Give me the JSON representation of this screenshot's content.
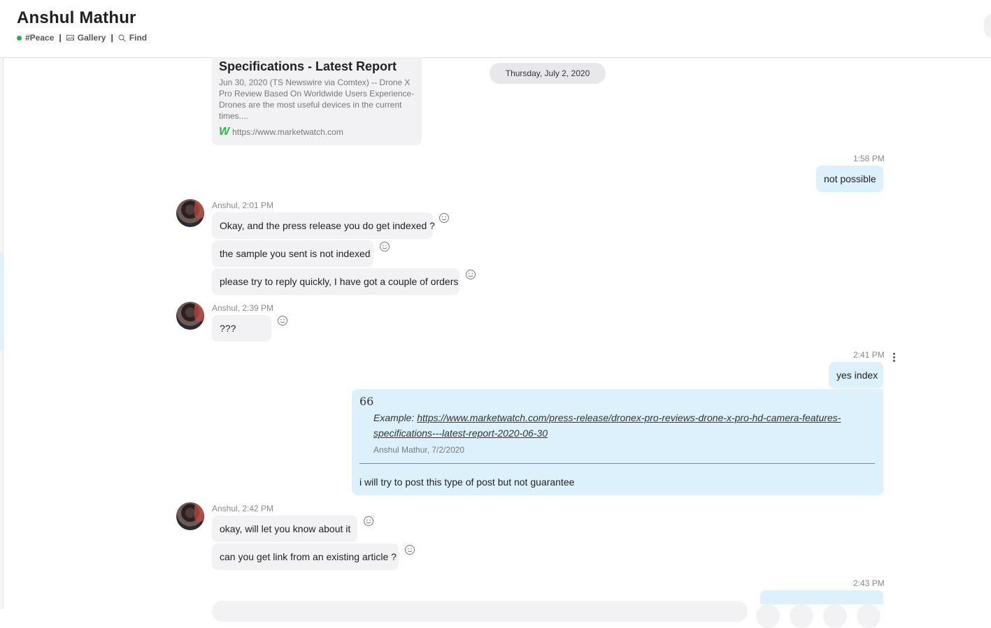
{
  "header": {
    "title": "Anshul Mathur",
    "mood": "#Peace",
    "gallery": "Gallery",
    "find": "Find"
  },
  "link_card": {
    "title": "Specifications - Latest Report",
    "desc": "Jun 30, 2020 (TS Newswire via Comtex) -- Drone X Pro Review Based On Worldwide Users Experience- Drones are the most useful devices in the current times....",
    "url": "https://www.marketwatch.com"
  },
  "date_divider": "Thursday, July 2, 2020",
  "messages": {
    "m1_time": "1:58 PM",
    "m1_text": "not possible",
    "g1_sender": "Anshul, 2:01 PM",
    "g1_a": "Okay, and the press release you do get indexed ?",
    "g1_b": "the sample you sent is not indexed",
    "g1_c": "please try to reply quickly, I have got a couple of orders",
    "g2_sender": "Anshul, 2:39 PM",
    "g2_a": "???",
    "m2_time": "2:41 PM",
    "m2_text": "yes index",
    "quote_mark": "66",
    "quote_prefix": "Example: ",
    "quote_link": "https://www.marketwatch.com/press-release/dronex-pro-reviews-drone-x-pro-hd-camera-features-specifications---latest-report-2020-06-30",
    "quote_author": "Anshul Mathur, 7/2/2020",
    "quote_reply": "i will try to post this type of post but not guarantee",
    "g3_sender": "Anshul, 2:42 PM",
    "g3_a": "okay, will let you know about it",
    "g3_b": "can you get link from an existing article ?",
    "m3_time": "2:43 PM"
  },
  "icons": {
    "reaction": "smiley-icon",
    "gallery": "gallery-icon",
    "find": "search-icon",
    "more": "more-vertical-icon"
  },
  "colors": {
    "outgoing_bubble": "#dcf1fb",
    "incoming_bubble": "#f2f2f4",
    "presence": "#22b14c"
  }
}
